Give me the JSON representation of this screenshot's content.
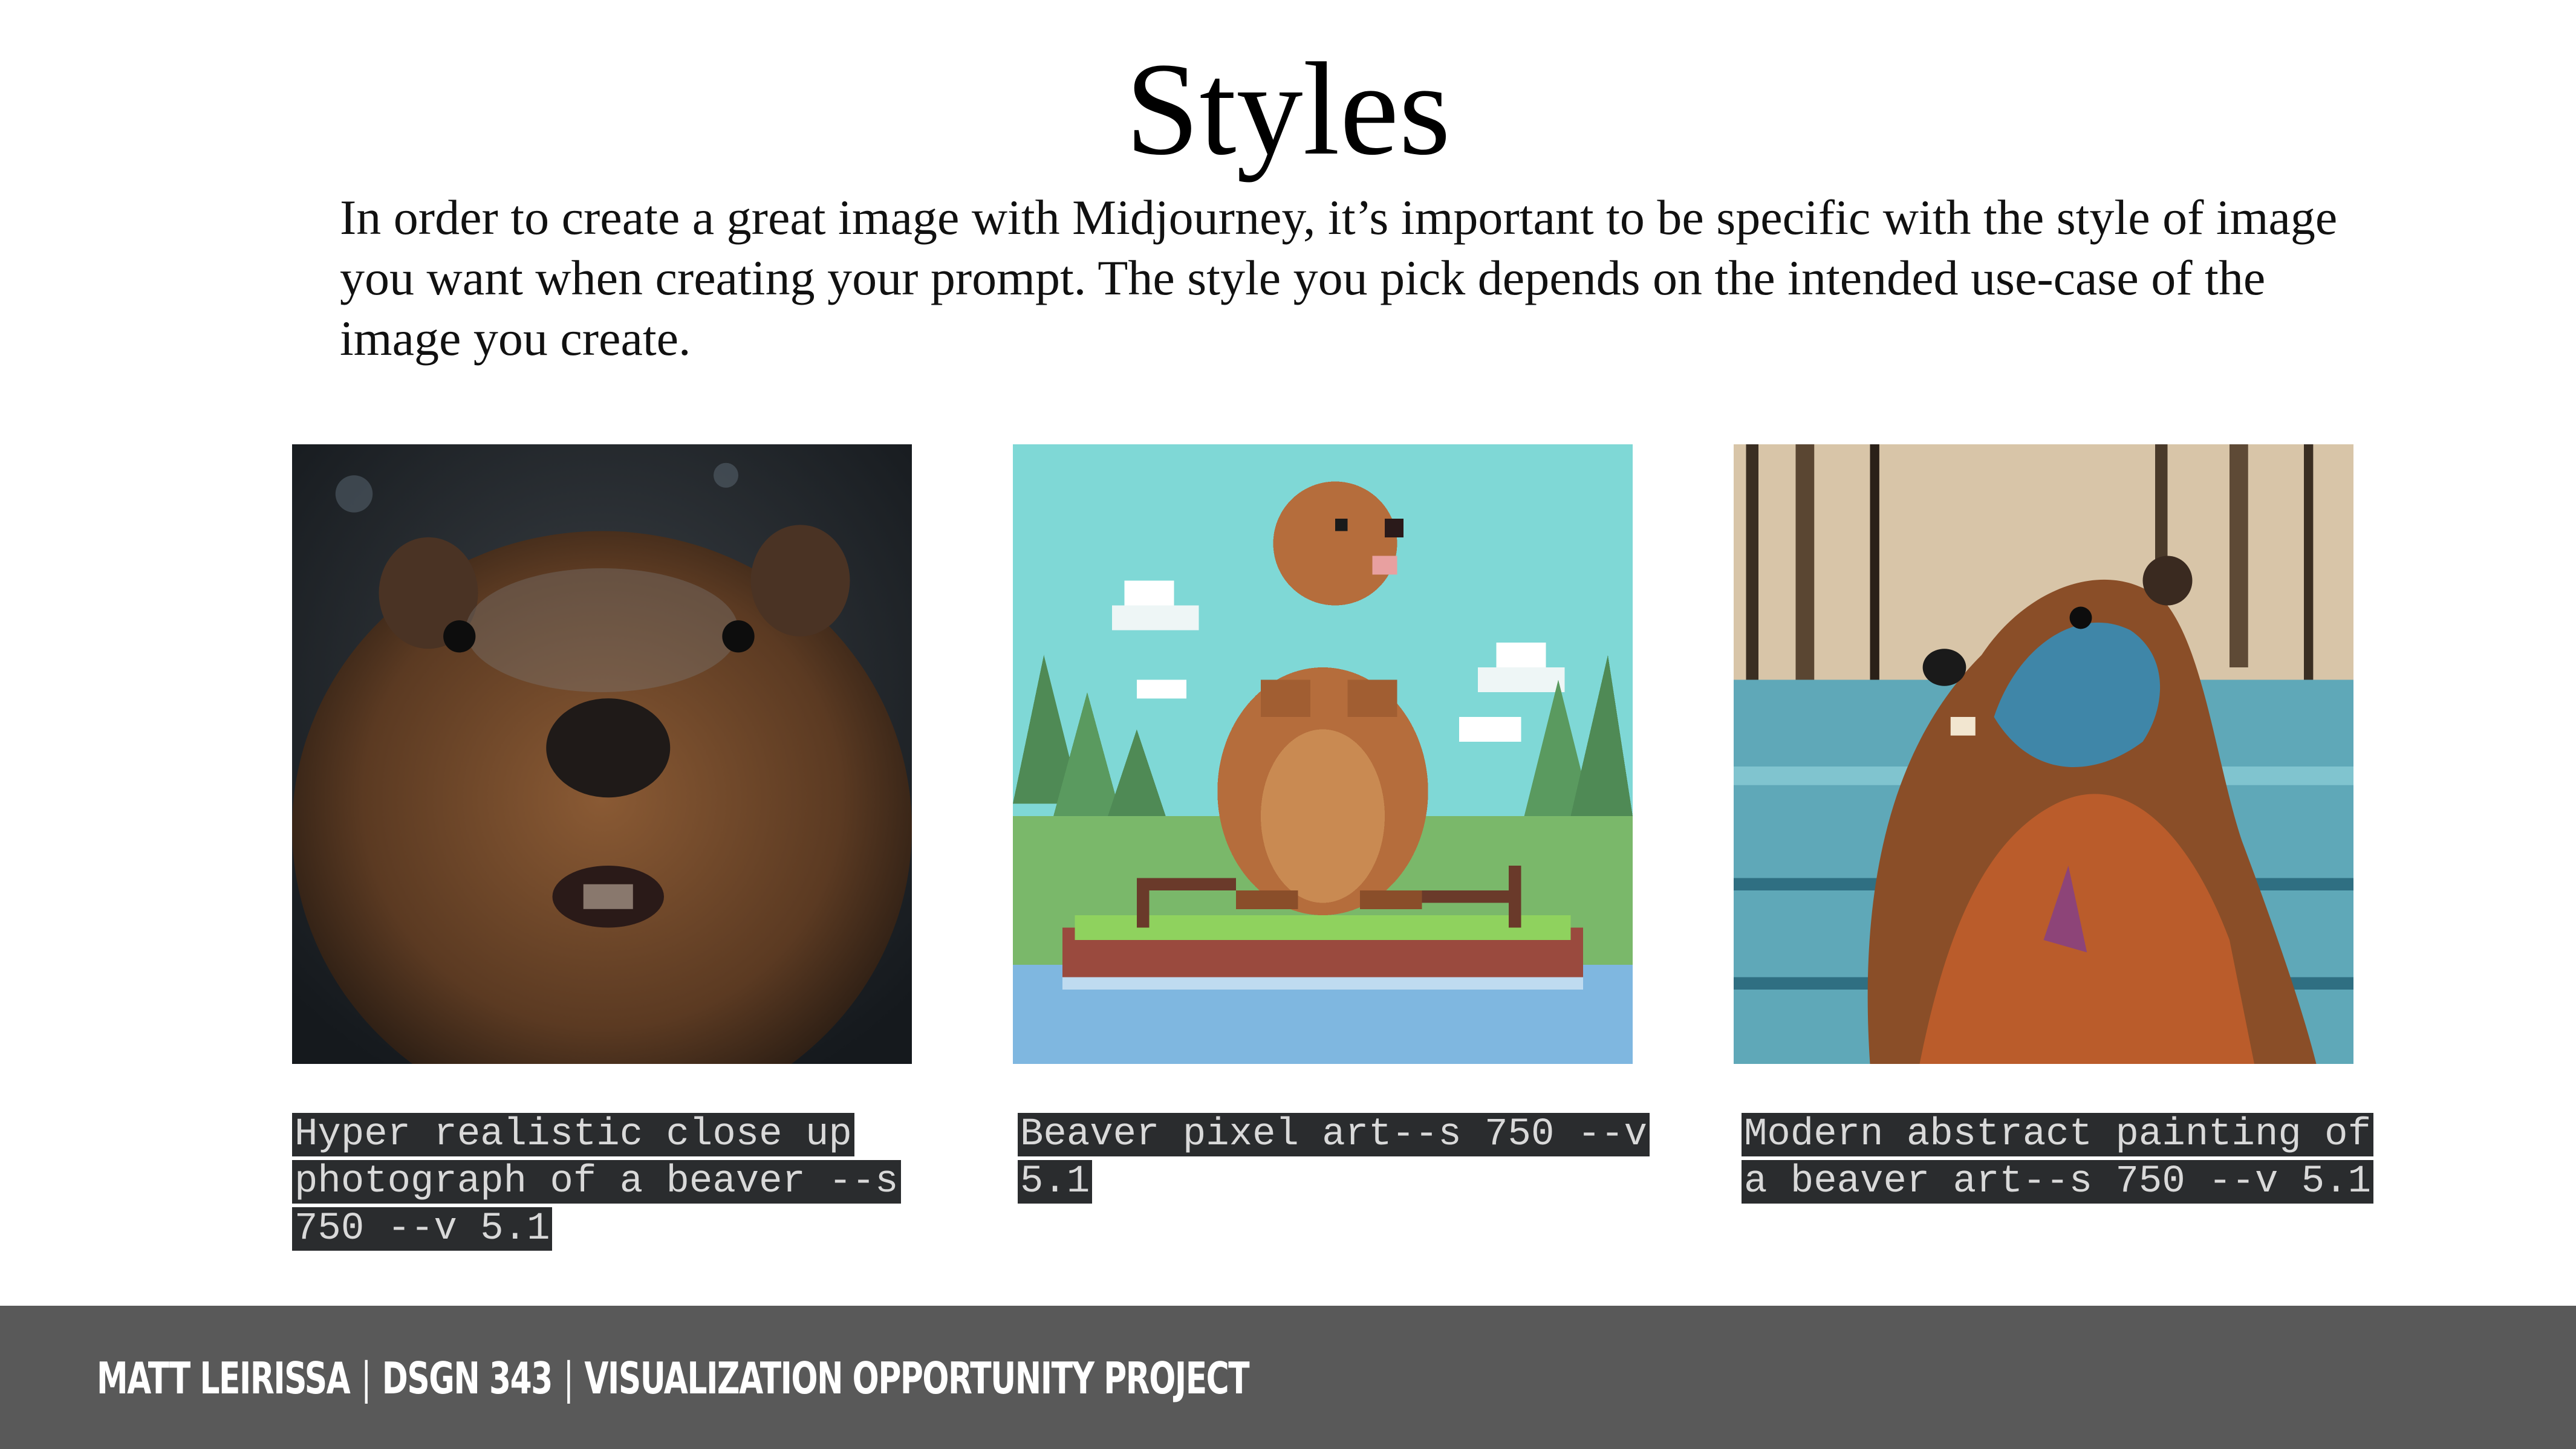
{
  "slide": {
    "title": "Styles",
    "intro": "In order to create a great image with Midjourney, it’s important to be specific with the style of image you want when creating your prompt. The style you pick depends on the intended use-case of the image you create."
  },
  "cards": [
    {
      "caption_lines": [
        "Hyper realistic close up",
        "photograph of a beaver --s",
        "750 --v 5.1"
      ],
      "image_icon": "beaver-photo-image"
    },
    {
      "caption_lines": [
        "Beaver pixel art--s 750 --v",
        "5.1"
      ],
      "image_icon": "beaver-pixel-art-image"
    },
    {
      "caption_lines": [
        "Modern abstract painting of",
        "a beaver art--s 750 --v 5.1"
      ],
      "image_icon": "beaver-abstract-painting-image"
    }
  ],
  "footer": {
    "author": "MATT LEIRISSA",
    "course": "DSGN 343",
    "project": "VISUALIZATION OPPORTUNITY PROJECT",
    "separator": "|"
  },
  "colors": {
    "footer_bg": "#595959",
    "caption_bg": "#2a2c2e",
    "caption_text": "#d9d9d9"
  }
}
